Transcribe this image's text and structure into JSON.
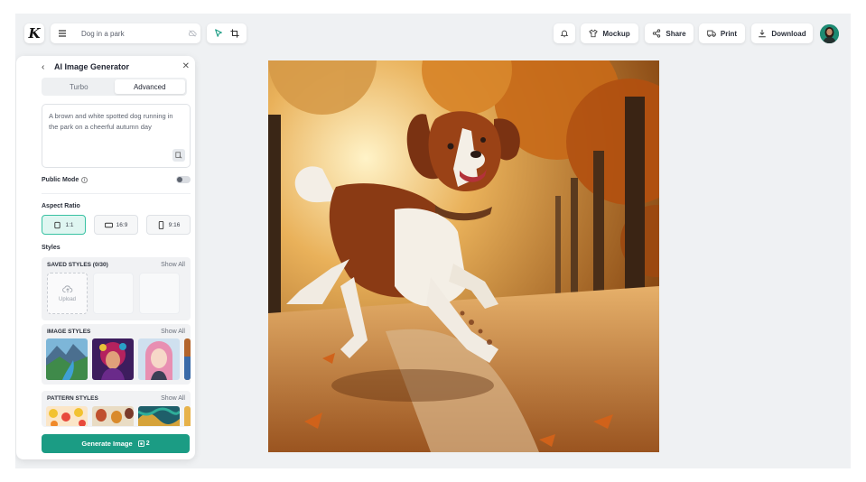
{
  "toolbar": {
    "logo_letter": "K",
    "document_name": "Dog in a park",
    "mockup_label": "Mockup",
    "share_label": "Share",
    "print_label": "Print",
    "download_label": "Download"
  },
  "panel": {
    "title": "AI Image Generator",
    "tabs": [
      {
        "label": "Turbo",
        "selected": false
      },
      {
        "label": "Advanced",
        "selected": true
      }
    ],
    "prompt": "A brown and white spotted dog running in the park on a cheerful autumn day",
    "public_mode_label": "Public Mode",
    "public_mode_on": false,
    "aspect_ratio_label": "Aspect Ratio",
    "aspect_ratios": [
      {
        "label": "1:1",
        "selected": true
      },
      {
        "label": "16:9",
        "selected": false
      },
      {
        "label": "9:16",
        "selected": false
      }
    ],
    "styles_label": "Styles",
    "saved_styles": {
      "title": "SAVED STYLES (0/30)",
      "show_all": "Show All",
      "upload_label": "Upload"
    },
    "image_styles": {
      "title": "IMAGE STYLES",
      "show_all": "Show All"
    },
    "pattern_styles": {
      "title": "PATTERN STYLES",
      "show_all": "Show All"
    },
    "generate_label": "Generate Image",
    "generate_cost": "2"
  },
  "colors": {
    "accent": "#1b9c84",
    "canvas_bg": "#eff1f3"
  },
  "icons": [
    "menu-icon",
    "cloud-off-icon",
    "cursor-icon",
    "crop-icon",
    "bell-icon",
    "tshirt-icon",
    "share-icon",
    "truck-icon",
    "download-icon",
    "edit-icon",
    "layout-icon",
    "text-icon",
    "shapes-icon",
    "briefcase-icon",
    "upload-icon",
    "image-icon",
    "pattern-icon",
    "sparkle-icon"
  ]
}
